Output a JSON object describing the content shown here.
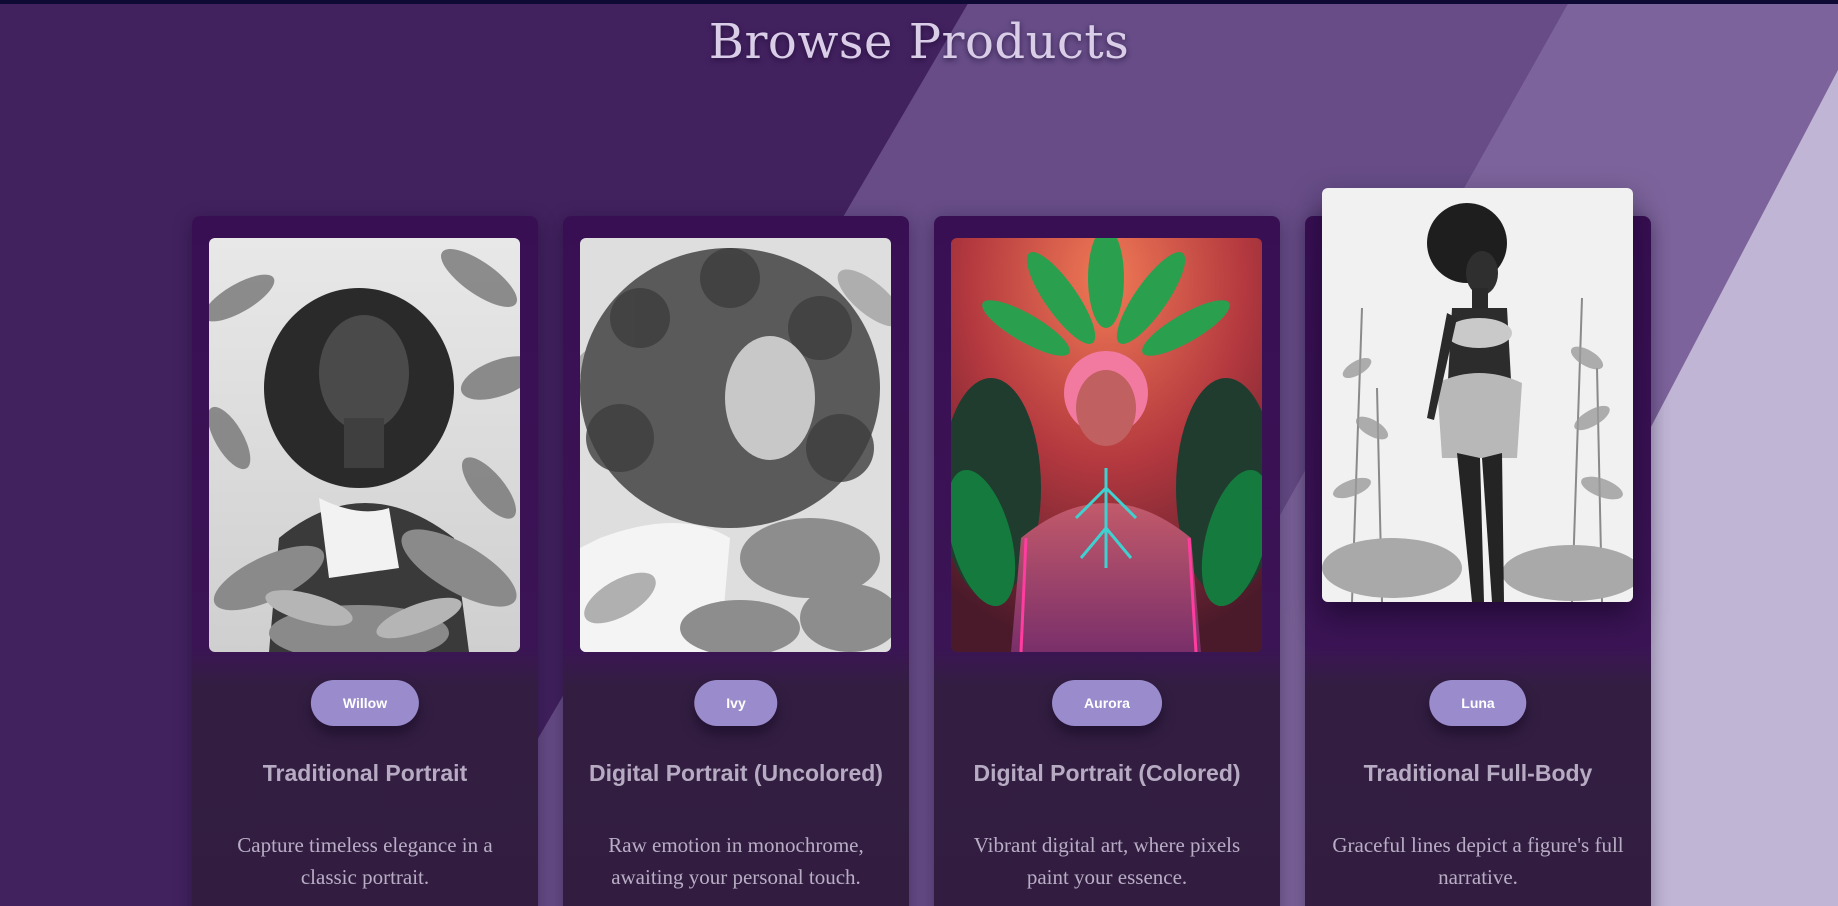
{
  "page": {
    "title": "Browse Products"
  },
  "colors": {
    "background_dark": "#42215f",
    "background_mid": "#674c87",
    "background_light": "#c1b5d6",
    "card_top": "#390f54",
    "card_bottom": "#321d40",
    "pill": "#9a8ccc",
    "title_text": "#d9cde8"
  },
  "products": [
    {
      "name": "Willow",
      "title": "Traditional Portrait",
      "description": "Capture timeless elegance in a classic portrait.",
      "image": "graphite portrait of woman with curly hair among tropical leaves"
    },
    {
      "name": "Ivy",
      "title": "Digital Portrait (Uncolored)",
      "description": "Raw emotion in monochrome, awaiting your personal touch.",
      "image": "monochrome portrait of woman with voluminous curls among flowers"
    },
    {
      "name": "Aurora",
      "title": "Digital Portrait (Colored)",
      "description": "Vibrant digital art, where pixels paint your essence.",
      "image": "colorful neon figure with green leaf crown on red-orange backdrop"
    },
    {
      "name": "Luna",
      "title": "Traditional Full-Body",
      "description": "Graceful lines depict a figure's full narrative.",
      "image": "full-body graphite figure in floral outfit among tall plants"
    }
  ]
}
